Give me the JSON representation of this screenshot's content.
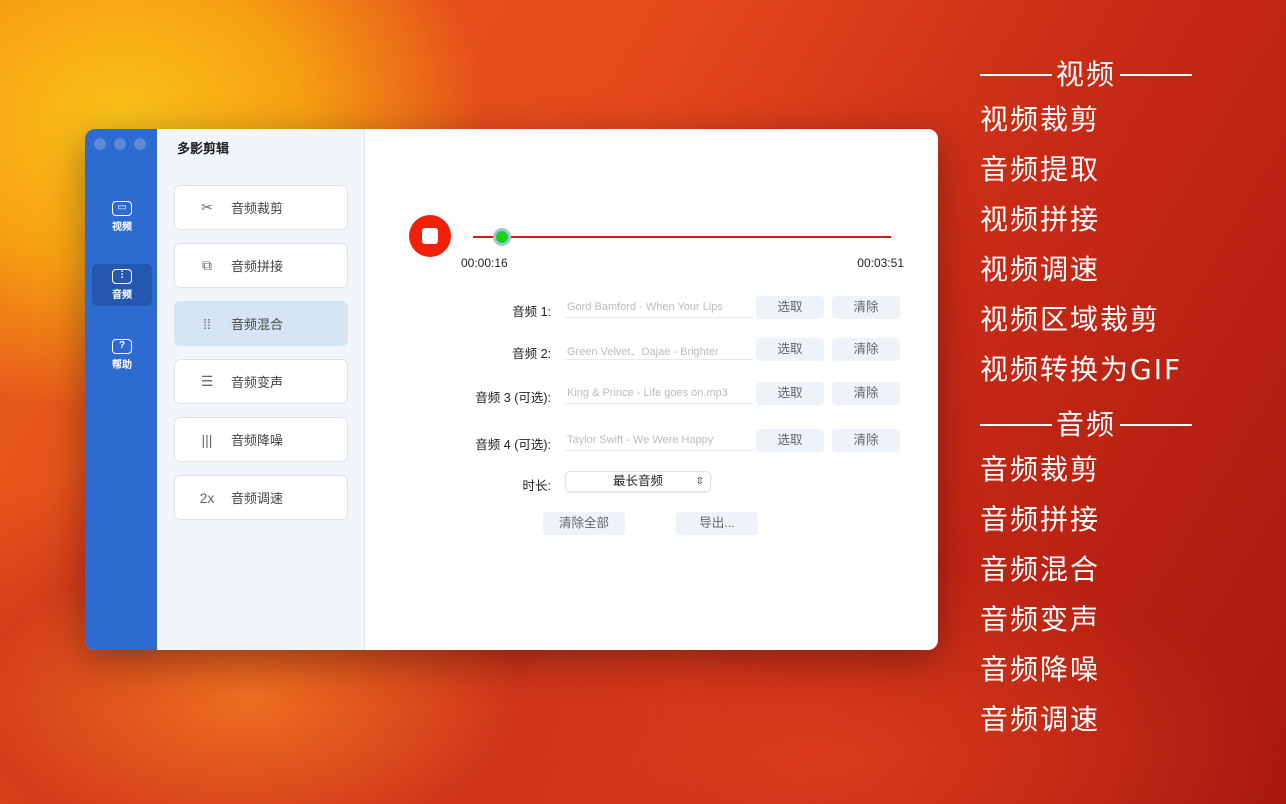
{
  "window": {
    "title": "多影剪辑"
  },
  "sidebar": {
    "items": [
      {
        "label": "视频",
        "icon": "video-camera-icon"
      },
      {
        "label": "音频",
        "icon": "audio-wave-icon",
        "active": true
      },
      {
        "label": "帮助",
        "icon": "help-question-icon"
      }
    ]
  },
  "tools": [
    {
      "label": "音频裁剪",
      "icon": "audio-cut-icon"
    },
    {
      "label": "音频拼接",
      "icon": "audio-merge-icon"
    },
    {
      "label": "音频混合",
      "icon": "audio-mix-icon",
      "active": true
    },
    {
      "label": "音频变声",
      "icon": "sliders-icon"
    },
    {
      "label": "音频降噪",
      "icon": "noise-reduce-icon"
    },
    {
      "label": "音频调速",
      "icon": "speed-2x-icon"
    }
  ],
  "player": {
    "current": "00:00:16",
    "total": "00:03:51",
    "progress": 0.069,
    "accent": "#e81010"
  },
  "tracks": [
    {
      "label": "音频 1:",
      "value": "Gord Bamford - When Your Lips"
    },
    {
      "label": "音频 2:",
      "value": "Green Velvet、Dajae - Brighter"
    },
    {
      "label": "音频 3 (可选):",
      "value": "King & Prince - Life goes on.mp3"
    },
    {
      "label": "音频 4 (可选):",
      "value": "Taylor Swift - We Were Happy"
    }
  ],
  "buttons": {
    "select": "选取",
    "clear": "清除",
    "clear_all": "清除全部",
    "export": "导出..."
  },
  "duration": {
    "label": "时长:",
    "value": "最长音频"
  },
  "features": {
    "video_header": "视频",
    "video": [
      "视频裁剪",
      "音频提取",
      "视频拼接",
      "视频调速",
      "视频区域裁剪",
      "视频转换为GIF"
    ],
    "audio_header": "音频",
    "audio": [
      "音频裁剪",
      "音频拼接",
      "音频混合",
      "音频变声",
      "音频降噪",
      "音频调速"
    ]
  }
}
